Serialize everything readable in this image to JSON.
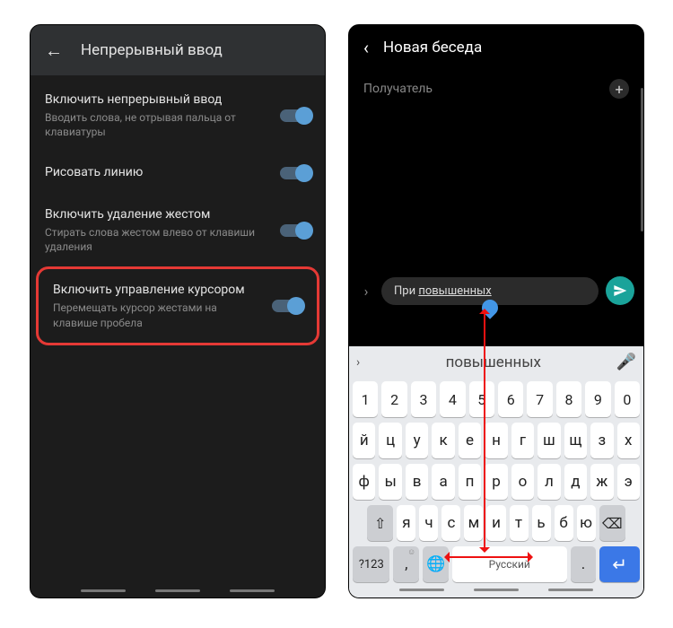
{
  "left": {
    "header_title": "Непрерывный ввод",
    "settings": [
      {
        "title": "Включить непрерывный ввод",
        "sub": "Вводить слова, не отрывая пальца от клавиатуры"
      },
      {
        "title": "Рисовать линию",
        "sub": ""
      },
      {
        "title": "Включить удаление жестом",
        "sub": "Стирать слова жестом влево от клавиши удаления"
      },
      {
        "title": "Включить управление курсором",
        "sub": "Перемещать курсор жестами на клавише пробела"
      }
    ]
  },
  "right": {
    "header_title": "Новая беседа",
    "recipient_placeholder": "Получатель",
    "compose_text_prefix": "При ",
    "compose_text_underlined": "повышенных",
    "suggestion": "повышенных",
    "keyboard": {
      "row_num": [
        "1",
        "2",
        "3",
        "4",
        "5",
        "6",
        "7",
        "8",
        "9",
        "0"
      ],
      "row1": [
        "й",
        "ц",
        "у",
        "к",
        "е",
        "н",
        "г",
        "ш",
        "щ",
        "з",
        "х"
      ],
      "row2": [
        "ф",
        "ы",
        "в",
        "а",
        "п",
        "р",
        "о",
        "л",
        "д",
        "ж",
        "э"
      ],
      "row3": [
        "я",
        "ч",
        "с",
        "м",
        "и",
        "т",
        "ь",
        "б",
        "ю"
      ],
      "bottom": {
        "sym": "?123",
        "comma": ",",
        "space": "Русский",
        "dot": "."
      }
    }
  }
}
